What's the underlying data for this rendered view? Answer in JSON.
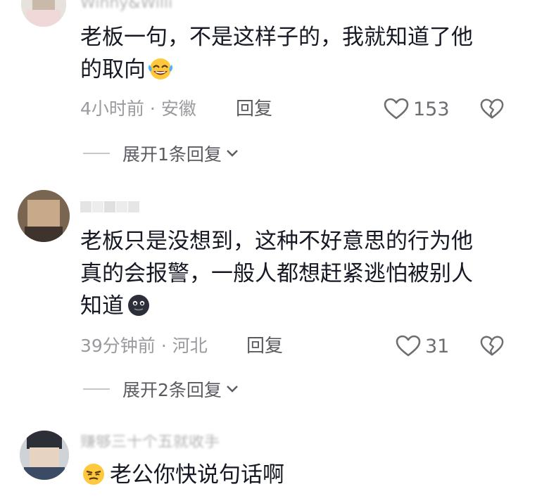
{
  "comments": [
    {
      "username": "Winny&Willi",
      "lines": [
        "老板一句，不是这样子的，我就知道了他",
        "的取向"
      ],
      "emoji": "laughing-crying-emoji",
      "time": "4小时前",
      "location": "安徽",
      "reply_label": "回复",
      "likes": "153",
      "expand_label": "展开1条回复"
    },
    {
      "username": "",
      "lines": [
        "老板只是没想到，这种不好意思的行为他",
        "真的会报警，一般人都想赶紧逃怕被别人",
        "知道"
      ],
      "emoji": "black-face-emoji",
      "time": "39分钟前",
      "location": "河北",
      "reply_label": "回复",
      "likes": "31",
      "expand_label": "展开2条回复"
    },
    {
      "username": "赚够三十个五就收手",
      "lines": [
        "老公你快说句话啊"
      ],
      "emoji": "smirk-emoji",
      "time": "",
      "location": "",
      "reply_label": "",
      "likes": "",
      "expand_label": ""
    }
  ],
  "icons": {
    "like": "heart-outline-icon",
    "dislike": "broken-heart-icon",
    "expand": "chevron-down-icon"
  },
  "colors": {
    "text": "#161823",
    "meta": "#9a9a9f",
    "action": "#5a5a60"
  }
}
